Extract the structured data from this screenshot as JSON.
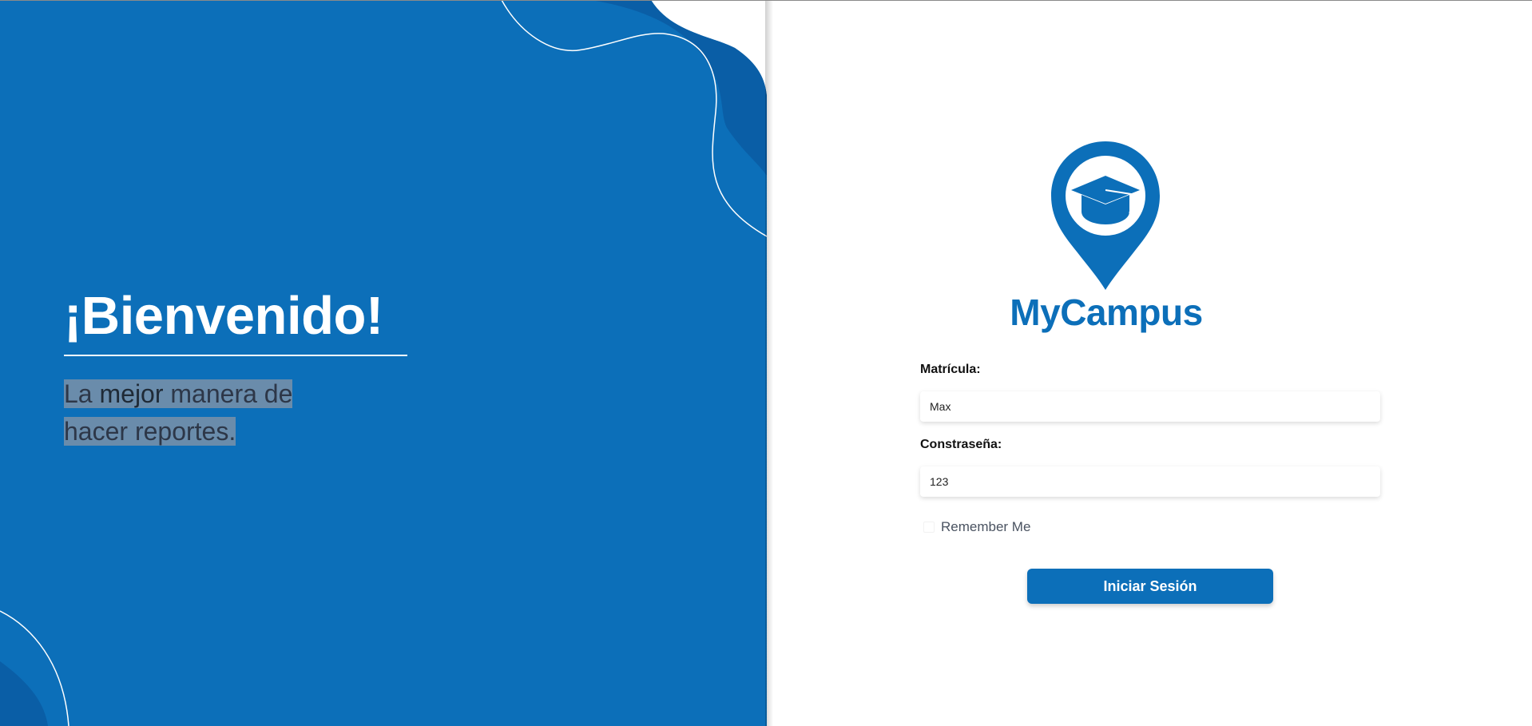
{
  "welcome": {
    "title": "¡Bienvenido!",
    "tagline_part1": "La ",
    "tagline_bold": "mejor",
    "tagline_part2": " manera de",
    "tagline_line2": "hacer reportes."
  },
  "brand": {
    "name": "MyCampus",
    "logo_icon": "graduation-cap-location-pin-icon"
  },
  "form": {
    "matricula_label": "Matrícula:",
    "matricula_value": "Max",
    "password_label": "Constraseña:",
    "password_value": "123",
    "remember_label": "Remember Me",
    "submit_label": "Iniciar Sesión"
  },
  "colors": {
    "brand_blue": "#0c6fb9",
    "dark_wave": "#0a5ea6",
    "white": "#ffffff"
  }
}
